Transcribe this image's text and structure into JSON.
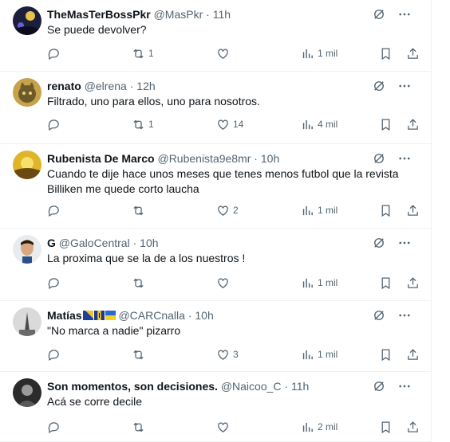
{
  "tweets": [
    {
      "name": "TheMasTerBossPkr",
      "handle": "@MasPkr",
      "time": "11h",
      "text": [
        "Se puede devolver?"
      ],
      "replies": "",
      "retweets": "1",
      "likes": "",
      "views": "1 mil",
      "avatar": "dark-night-avatar",
      "flags": []
    },
    {
      "name": "renato",
      "handle": "@elrena",
      "time": "12h",
      "text": [
        "Filtrado, uno para ellos, uno para nosotros."
      ],
      "replies": "",
      "retweets": "1",
      "likes": "14",
      "views": "4 mil",
      "avatar": "cat-avatar",
      "flags": []
    },
    {
      "name": "Rubenista De Marco",
      "handle": "@Rubenista9e8mr",
      "time": "10h",
      "text": [
        "Cuando te dije hace unos meses que tenes menos futbol que la revista",
        "Billiken me quede corto laucha"
      ],
      "replies": "",
      "retweets": "",
      "likes": "2",
      "views": "1 mil",
      "avatar": "sunset-avatar",
      "flags": []
    },
    {
      "name": "G",
      "handle": "@GaloCentral",
      "time": "10h",
      "text": [
        "La proxima que se la de a los nuestros !"
      ],
      "replies": "",
      "retweets": "",
      "likes": "",
      "views": "1 mil",
      "avatar": "face-avatar",
      "flags": []
    },
    {
      "name": "Matías",
      "handle": "@CARCnalla",
      "time": "10h",
      "text": [
        "\"No marca a nadie\" pizarro"
      ],
      "replies": "",
      "retweets": "",
      "likes": "3",
      "views": "1 mil",
      "avatar": "tower-avatar",
      "flags": [
        "bosnia-flag",
        "barbados-flag",
        "ukraine-flag"
      ]
    },
    {
      "name": "Son momentos, son decisiones.",
      "handle": "@Naicoo_C",
      "time": "11h",
      "text": [
        "Acá se corre decile"
      ],
      "replies": "",
      "retweets": "",
      "likes": "",
      "views": "2 mil",
      "avatar": "bw-portrait-avatar",
      "flags": []
    }
  ],
  "colors": {
    "text": "#0f1419",
    "muted": "#536471",
    "border": "#eff3f4"
  }
}
